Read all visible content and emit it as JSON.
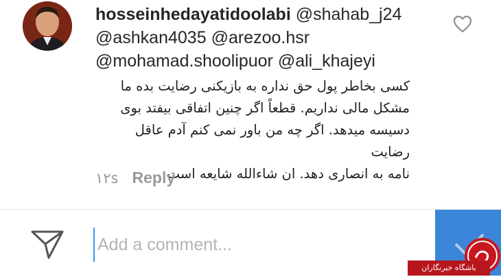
{
  "comment": {
    "username": "hosseinhedayatidoolabi",
    "mentions": [
      "@shahab_j24",
      "@ashkan4035",
      "@arezoo.hsr",
      "@mohamad.shoolipuor",
      "@ali_khajeyi"
    ],
    "message_lines": [
      "کسی بخاطر پول حق نداره به بازیکنی رضایت بده ما",
      "مشکل مالی نداریم. قطعاً اگر چنین اتفاقی بیفتد بوی",
      "دسیسه میدهد. اگر چه من باور نمی کنم آدم عاقل رضایت",
      "نامه به انصاری دهد. ان شاءالله شایعه است"
    ],
    "timestamp": "۱۲s",
    "reply_label": "Reply",
    "like_icon": "heart-outline-icon"
  },
  "footer": {
    "send_icon": "paper-plane-icon",
    "input_placeholder": "Add a comment...",
    "input_value": "",
    "post_button_color": "#3b86d8"
  },
  "watermark": {
    "text": "باشگاه خبرنگاران"
  },
  "colors": {
    "username": "#262626",
    "meta_text": "#999999",
    "accent": "#3897f0",
    "watermark_red": "#b8161d"
  }
}
